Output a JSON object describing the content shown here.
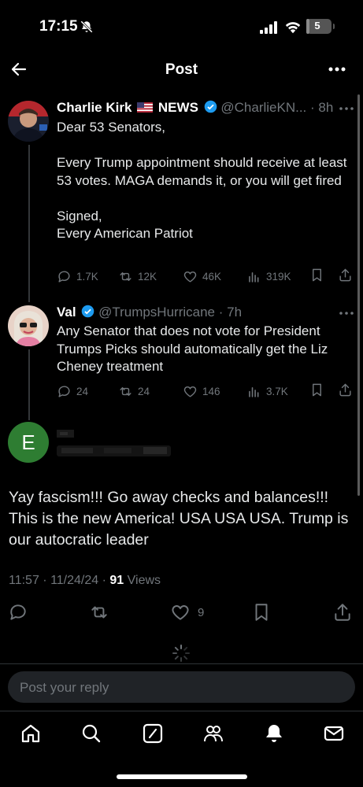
{
  "status": {
    "time": "17:15",
    "battery": "5",
    "battery_level": 0.05
  },
  "header": {
    "title": "Post"
  },
  "thread": [
    {
      "name": "Charlie Kirk",
      "name_suffix": "NEWS",
      "handle": "@CharlieKN...",
      "time": "· 8h",
      "text": "Dear 53 Senators,\n\nEvery Trump appointment should receive at least 53 votes. MAGA demands it, or you will get fired\n\nSigned,\nEvery American Patriot",
      "replies": "1.7K",
      "reposts": "12K",
      "likes": "46K",
      "views": "319K"
    },
    {
      "name": "Val",
      "handle": "@TrumpsHurricane",
      "time": "· 7h",
      "text": "Any Senator that does not vote for President Trumps Picks should automatically get the Liz Cheney treatment",
      "replies": "24",
      "reposts": "24",
      "likes": "146",
      "views": "3.7K"
    }
  ],
  "main_post": {
    "avatar_letter": "E",
    "text": "Yay fascism!!! Go away checks and balances!!! This is the new America! USA USA USA. Trump is our autocratic leader",
    "timestamp": "11:57 · 11/24/24 · ",
    "views_count": "91",
    "views_label": " Views",
    "likes": "9"
  },
  "reply": {
    "placeholder": "Post your reply"
  },
  "colors": {
    "accent": "#1d9bf0",
    "muted": "#71767b",
    "avatar_e": "#2e7d32"
  }
}
